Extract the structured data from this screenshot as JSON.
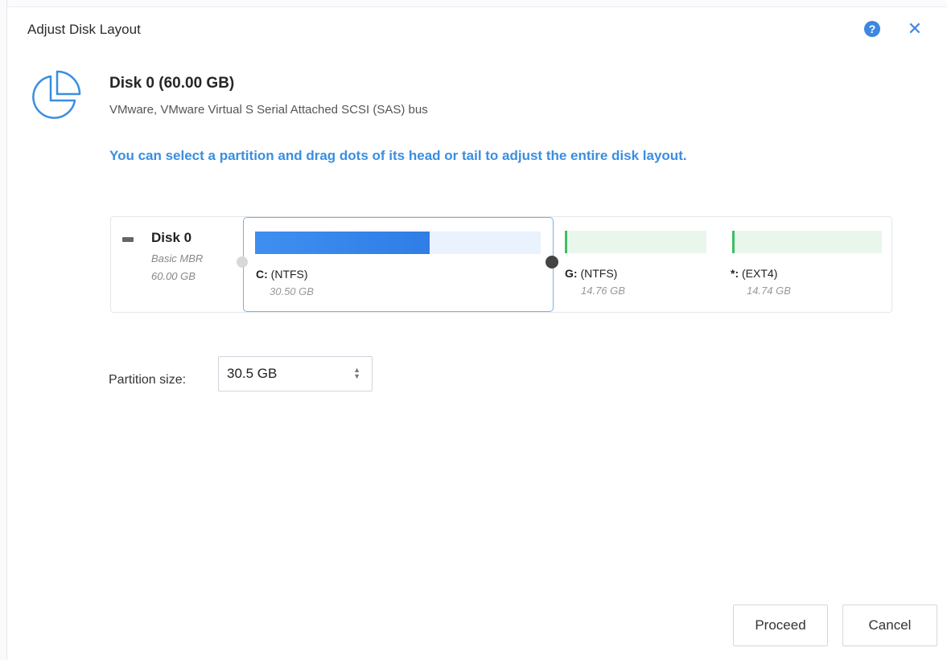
{
  "dialog": {
    "title": "Adjust Disk Layout",
    "help_icon": "help-icon",
    "help_glyph": "?",
    "close_icon": "close-icon",
    "close_glyph": "✕"
  },
  "disk": {
    "icon": "pie-chart-icon",
    "title": "Disk 0 (60.00 GB)",
    "subtitle": "VMware,  VMware Virtual S Serial Attached SCSI (SAS) bus",
    "hint": "You can select a partition and drag dots of its head or tail to adjust the entire disk layout."
  },
  "disk_map": {
    "name": "Disk 0",
    "type": "Basic MBR",
    "size": "60.00 GB",
    "partitions": [
      {
        "letter": "C:",
        "fs": "(NTFS)",
        "size": "30.50 GB",
        "used_fraction": 0.61,
        "color": "#3a8aec",
        "selected": true
      },
      {
        "letter": "G:",
        "fs": "(NTFS)",
        "size": "14.76 GB",
        "used_fraction": 0.0,
        "color": "#3cbf63",
        "selected": false
      },
      {
        "letter": "*:",
        "fs": "(EXT4)",
        "size": "14.74 GB",
        "used_fraction": 0.0,
        "color": "#3cbf63",
        "selected": false
      }
    ]
  },
  "partition_size": {
    "label": "Partition size:",
    "value": "30.5 GB",
    "spinner_up": "▲",
    "spinner_down": "▼"
  },
  "buttons": {
    "proceed": "Proceed",
    "cancel": "Cancel"
  },
  "colors": {
    "accent": "#3a8ee0",
    "partition_used": "#3a8aec",
    "partition_other": "#3cbf63"
  }
}
